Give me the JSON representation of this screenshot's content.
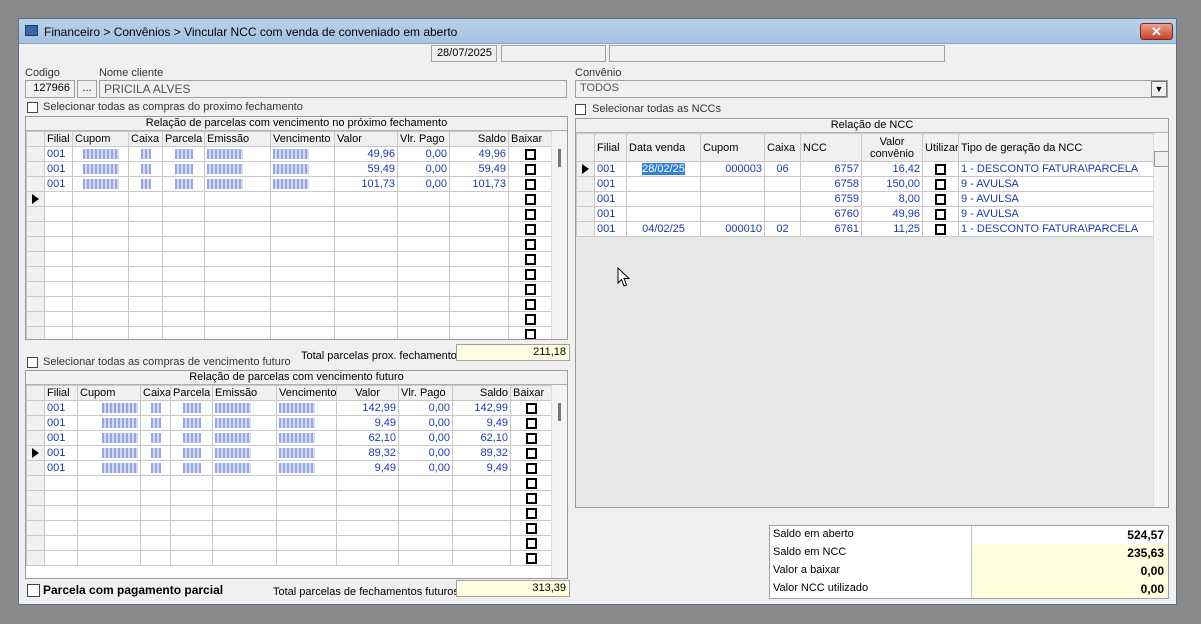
{
  "window": {
    "title": "Financeiro > Convênios > Vincular NCC com venda de conveniado em aberto",
    "date": "28/07/2025"
  },
  "icons": {
    "app": "app-icon",
    "close": "close-icon",
    "combo": "chevron-down-icon",
    "cursor": "mouse-cursor-icon"
  },
  "cliente": {
    "codigo_label": "Codigo",
    "codigo_value": "127966",
    "browse_label": "...",
    "nome_label": "Nome cliente",
    "nome_value": "PRICILA ALVES"
  },
  "convenio": {
    "label": "Convênio",
    "value": "TODOS",
    "select_all_ncc": "Selecionar todas as NCCs"
  },
  "proximo": {
    "select_all": "Selecionar todas as compras do proximo fechamento",
    "title": "Relação de parcelas com vencimento no próximo fechamento",
    "headers": [
      "Filial",
      "Cupom",
      "Caixa",
      "Parcela",
      "Emissão",
      "Vencimento",
      "Valor",
      "Vlr. Pago",
      "Saldo",
      "Baixar"
    ],
    "rows": [
      {
        "filial": "001",
        "valor": "49,96",
        "pago": "0,00",
        "saldo": "49,96"
      },
      {
        "filial": "001",
        "valor": "59,49",
        "pago": "0,00",
        "saldo": "59,49"
      },
      {
        "filial": "001",
        "valor": "101,73",
        "pago": "0,00",
        "saldo": "101,73"
      }
    ],
    "total_label": "Total parcelas prox. fechamento",
    "total_value": "211,18"
  },
  "futuro": {
    "select_all": "Selecionar todas as compras de vencimento futuro",
    "title": "Relação de parcelas com vencimento futuro",
    "headers": [
      "Filial",
      "Cupom",
      "Caixa",
      "Parcela",
      "Emissão",
      "Vencimento",
      "Valor",
      "Vlr. Pago",
      "Saldo",
      "Baixar"
    ],
    "rows": [
      {
        "filial": "001",
        "valor": "142,99",
        "pago": "0,00",
        "saldo": "142,99"
      },
      {
        "filial": "001",
        "valor": "9,49",
        "pago": "0,00",
        "saldo": "9,49"
      },
      {
        "filial": "001",
        "valor": "62,10",
        "pago": "0,00",
        "saldo": "62,10"
      },
      {
        "filial": "001",
        "valor": "89,32",
        "pago": "0,00",
        "saldo": "89,32"
      },
      {
        "filial": "001",
        "valor": "9,49",
        "pago": "0,00",
        "saldo": "9,49"
      }
    ],
    "parcial_label": "Parcela com pagamento parcial",
    "total_label": "Total parcelas de fechamentos futuros",
    "total_value": "313,39"
  },
  "ncc": {
    "title": "Relação de NCC",
    "headers": [
      "Filial",
      "Data venda",
      "Cupom",
      "Caixa",
      "NCC",
      "Valor convênio",
      "Utilizar",
      "Tipo de geração da NCC"
    ],
    "rows": [
      {
        "filial": "001",
        "data": "28/02/25",
        "cupom": "000003",
        "caixa": "06",
        "ncc": "6757",
        "valor": "16,42",
        "tipo": "1 - DESCONTO FATURA\\PARCELA"
      },
      {
        "filial": "001",
        "data": "",
        "cupom": "",
        "caixa": "",
        "ncc": "6758",
        "valor": "150,00",
        "tipo": "9 - AVULSA"
      },
      {
        "filial": "001",
        "data": "",
        "cupom": "",
        "caixa": "",
        "ncc": "6759",
        "valor": "8,00",
        "tipo": "9 - AVULSA"
      },
      {
        "filial": "001",
        "data": "",
        "cupom": "",
        "caixa": "",
        "ncc": "6760",
        "valor": "49,96",
        "tipo": "9 - AVULSA"
      },
      {
        "filial": "001",
        "data": "04/02/25",
        "cupom": "000010",
        "caixa": "02",
        "ncc": "6761",
        "valor": "11,25",
        "tipo": "1 - DESCONTO FATURA\\PARCELA"
      }
    ]
  },
  "summary": [
    {
      "label": "Saldo em aberto",
      "value": "524,57"
    },
    {
      "label": "Saldo em NCC",
      "value": "235,63"
    },
    {
      "label": "Valor a baixar",
      "value": "0,00"
    },
    {
      "label": "Valor NCC utilizado",
      "value": "0,00"
    }
  ]
}
